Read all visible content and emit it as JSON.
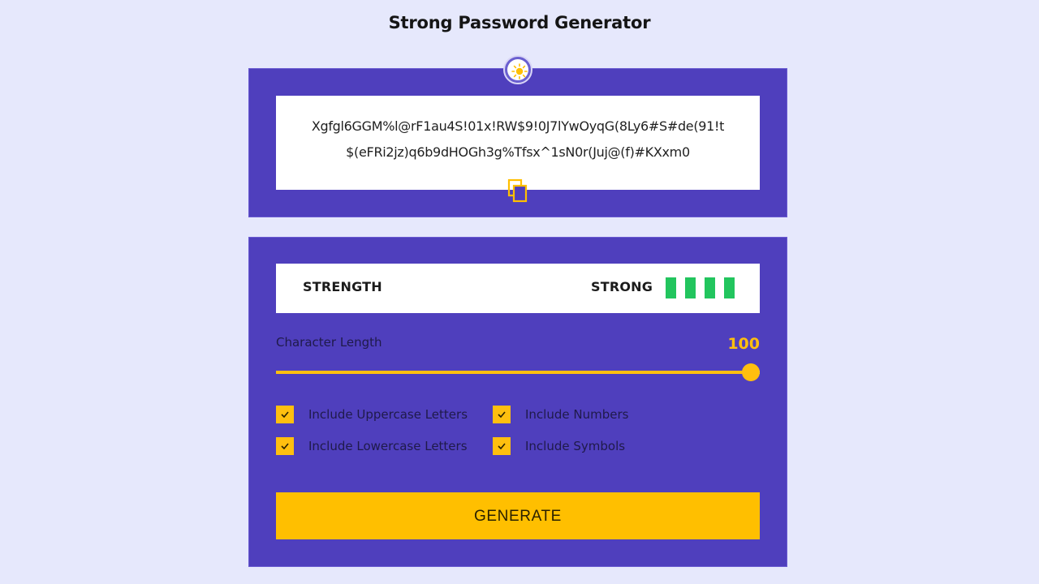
{
  "page": {
    "title": "Strong Password Generator"
  },
  "theme_toggle": {
    "icon": "sun-icon"
  },
  "password": {
    "value": "Xgfgl6GGM%l@rF1au4S!01x!RW$9!0J7lYwOyqG(8Ly6#S#de(91!t$(eFRi2jz)q6b9dHOGh3g%Tfsx^1sN0r(Juj@(f)#KXxm0",
    "copy_icon": "copy-icon"
  },
  "strength": {
    "label": "STRENGTH",
    "value": "STRONG",
    "bars_filled": 4,
    "bars_total": 4,
    "bar_color": "#22c55e"
  },
  "length": {
    "label": "Character Length",
    "value": "100",
    "slider_fraction": 1.0
  },
  "options": {
    "uppercase": {
      "label": "Include Uppercase Letters",
      "checked": true
    },
    "lowercase": {
      "label": "Include Lowercase Letters",
      "checked": true
    },
    "numbers": {
      "label": "Include Numbers",
      "checked": true
    },
    "symbols": {
      "label": "Include Symbols",
      "checked": true
    }
  },
  "generate": {
    "label": "GENERATE"
  },
  "colors": {
    "background": "#e6e8fc",
    "panel": "#4f3fbd",
    "accent": "#ffbf00",
    "strength_ok": "#22c55e"
  }
}
